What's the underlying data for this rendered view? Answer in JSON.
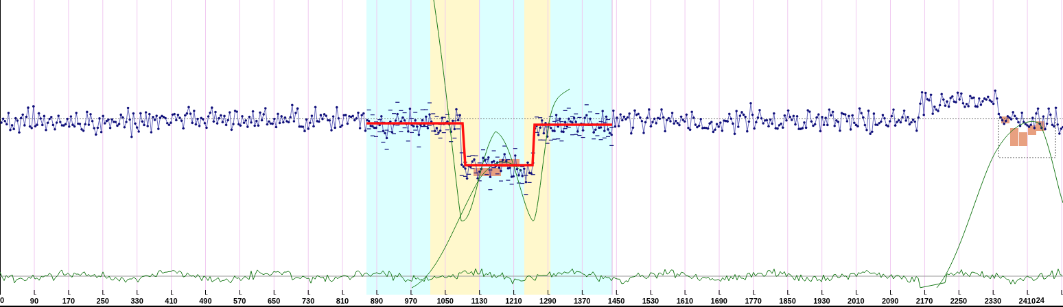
{
  "x_axis": {
    "tick_labels": [
      "0",
      "90",
      "170",
      "250",
      "330",
      "410",
      "490",
      "570",
      "650",
      "730",
      "810",
      "890",
      "970",
      "1050",
      "1130",
      "1210",
      "1290",
      "1370",
      "1450",
      "1530",
      "1610",
      "1690",
      "1770",
      "1850",
      "1930",
      "2010",
      "2090",
      "2170",
      "2250",
      "2330",
      "2410",
      "24"
    ]
  }
}
